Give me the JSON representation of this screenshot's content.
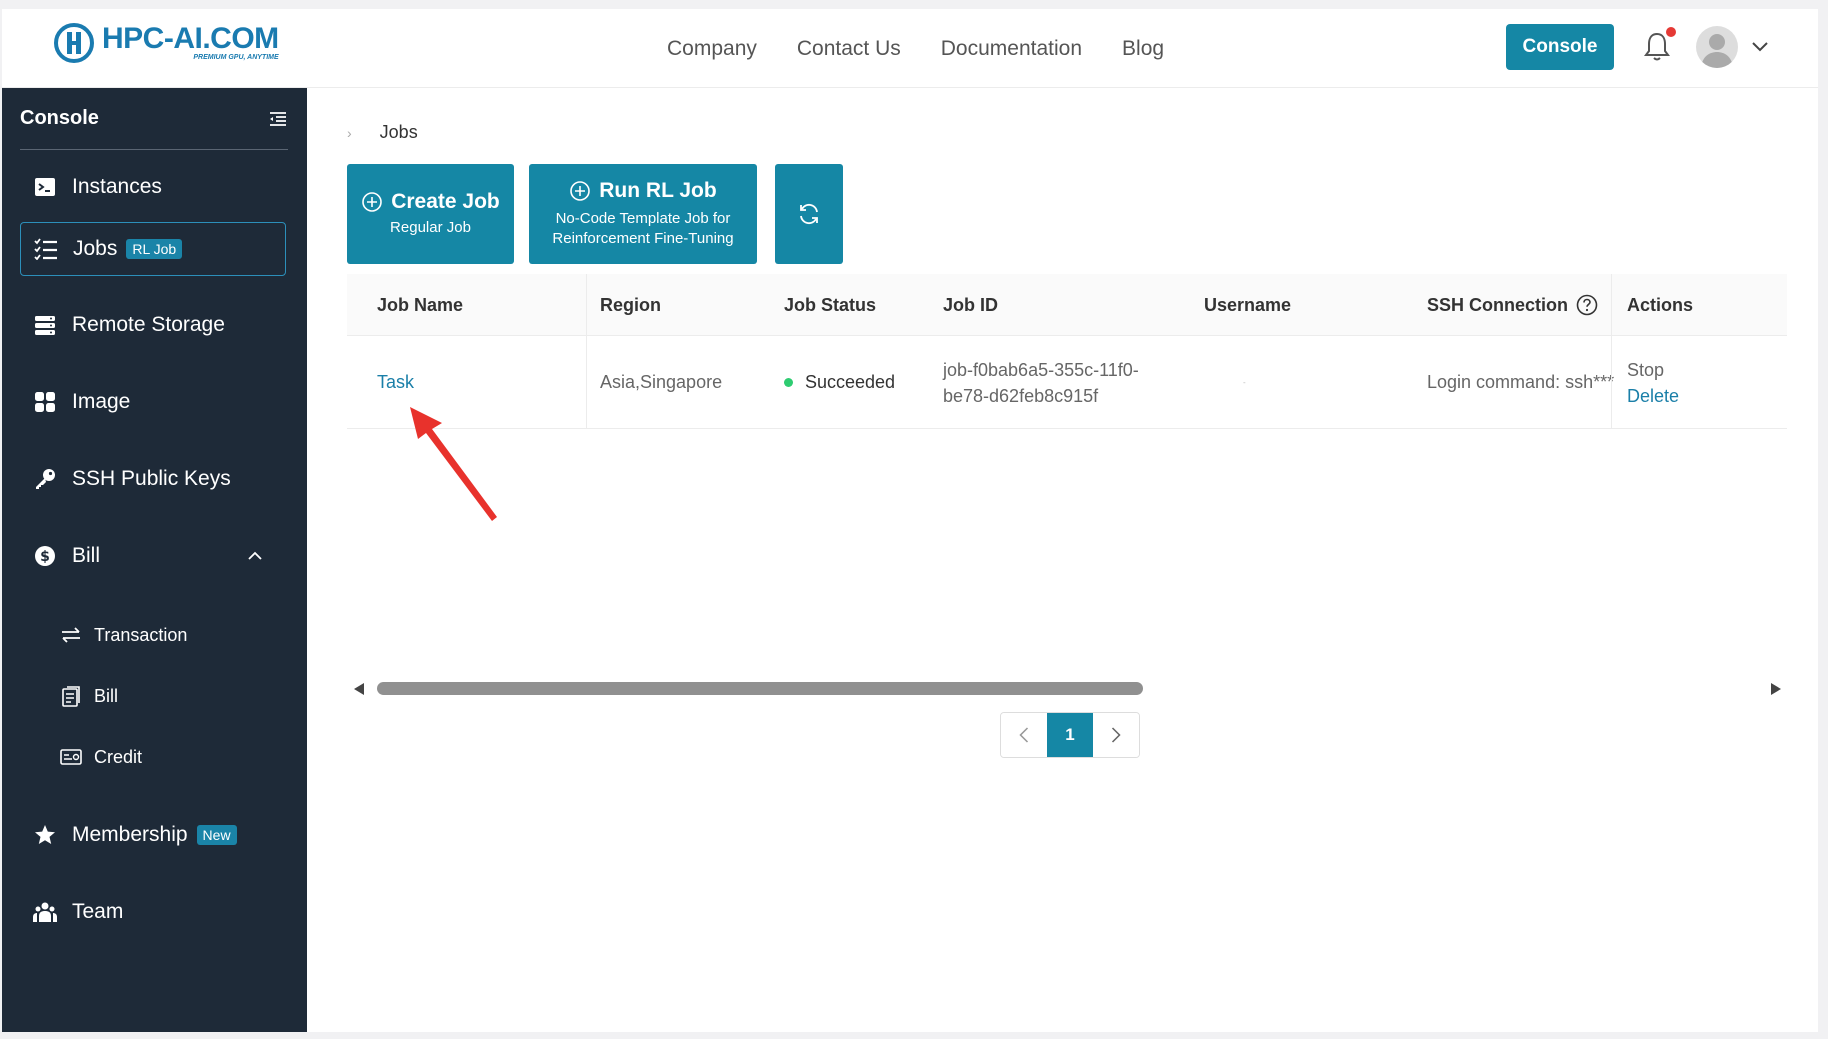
{
  "header": {
    "logo_main": "HPC-AI.COM",
    "logo_sub": "PREMIUM GPU, ANYTIME",
    "nav": [
      "Company",
      "Contact Us",
      "Documentation",
      "Blog"
    ],
    "console_label": "Console"
  },
  "sidebar": {
    "title": "Console",
    "items": [
      {
        "label": "Instances"
      },
      {
        "label": "Jobs",
        "badge": "RL Job"
      },
      {
        "label": "Remote Storage"
      },
      {
        "label": "Image"
      },
      {
        "label": "SSH Public Keys"
      },
      {
        "label": "Bill"
      },
      {
        "label": "Membership",
        "badge": "New"
      },
      {
        "label": "Team"
      }
    ],
    "bill_sub": [
      "Transaction",
      "Bill",
      "Credit"
    ]
  },
  "main": {
    "breadcrumb": "Jobs",
    "create_job": {
      "title": "Create Job",
      "subtitle": "Regular Job"
    },
    "run_rl_job": {
      "title": "Run RL Job",
      "subtitle_1": "No-Code Template Job for",
      "subtitle_2": "Reinforcement Fine-Tuning"
    },
    "table": {
      "headers": [
        "Job Name",
        "Region",
        "Job Status",
        "Job ID",
        "Username",
        "SSH Connection",
        "Actions"
      ],
      "rows": [
        {
          "job_name": "Task",
          "region": "Asia,Singapore",
          "status": "Succeeded",
          "job_id_1": "job-f0bab6a5-355c-11f0-",
          "job_id_2": "be78-d62feb8c915f",
          "username": "-",
          "ssh": "Login command: ssh***",
          "action_stop": "Stop",
          "action_delete": "Delete"
        }
      ]
    },
    "pagination": {
      "current": "1"
    }
  },
  "colors": {
    "accent": "#1587a5",
    "sidebar_bg": "#1e2a38",
    "success": "#2ecc71",
    "annotation": "#e8322c"
  }
}
